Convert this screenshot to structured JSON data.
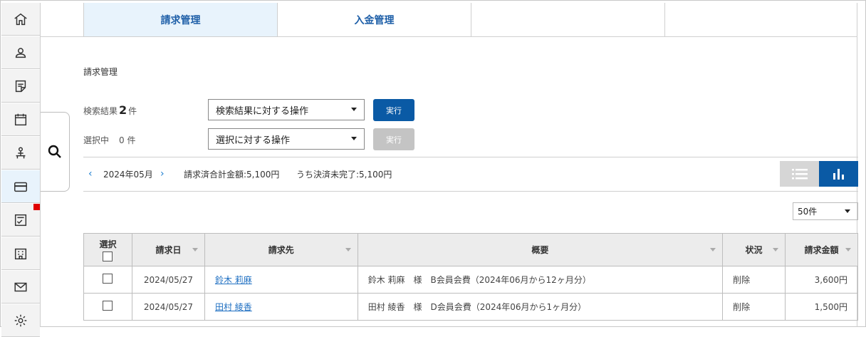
{
  "tabs": [
    {
      "label": "請求管理",
      "active": true
    },
    {
      "label": "入金管理",
      "active": false
    },
    {
      "label": "",
      "active": false
    },
    {
      "label": "",
      "active": false
    }
  ],
  "page": {
    "title": "請求管理"
  },
  "search_result": {
    "label": "検索結果",
    "count": "2",
    "unit": "件"
  },
  "selected": {
    "label": "選択中",
    "count": "0",
    "unit": "件"
  },
  "search_action": {
    "select_value": "検索結果に対する操作",
    "execute_label": "実行"
  },
  "selected_action": {
    "select_value": "選択に対する操作",
    "execute_label": "実行"
  },
  "summary": {
    "month": "2024年05月",
    "billed_total": "請求済合計金額:5,100円",
    "unsettled": "うち決済未完了:5,100円"
  },
  "per_page": "50件",
  "table": {
    "headers": [
      "選択",
      "請求日",
      "請求先",
      "概要",
      "状況",
      "請求金額"
    ],
    "rows": [
      {
        "date": "2024/05/27",
        "client": "鈴木 莉麻",
        "summary": "鈴木 莉麻　様　B会員会費（2024年06月から12ヶ月分）",
        "status": "削除",
        "amount": "3,600円"
      },
      {
        "date": "2024/05/27",
        "client": "田村 綾香",
        "summary": "田村 綾香　様　D会員会費（2024年06月から1ヶ月分）",
        "status": "削除",
        "amount": "1,500円"
      }
    ]
  },
  "colors": {
    "accent": "#0a5aa5",
    "active_tab_bg": "#e8f3fc",
    "alert": "#e00000"
  },
  "icons": [
    "home-icon",
    "user-icon",
    "note-icon",
    "calendar-icon",
    "org-icon",
    "card-icon",
    "checklist-icon",
    "building-icon",
    "mail-icon",
    "gear-icon",
    "search-icon",
    "list-view-icon",
    "bar-chart-icon"
  ]
}
